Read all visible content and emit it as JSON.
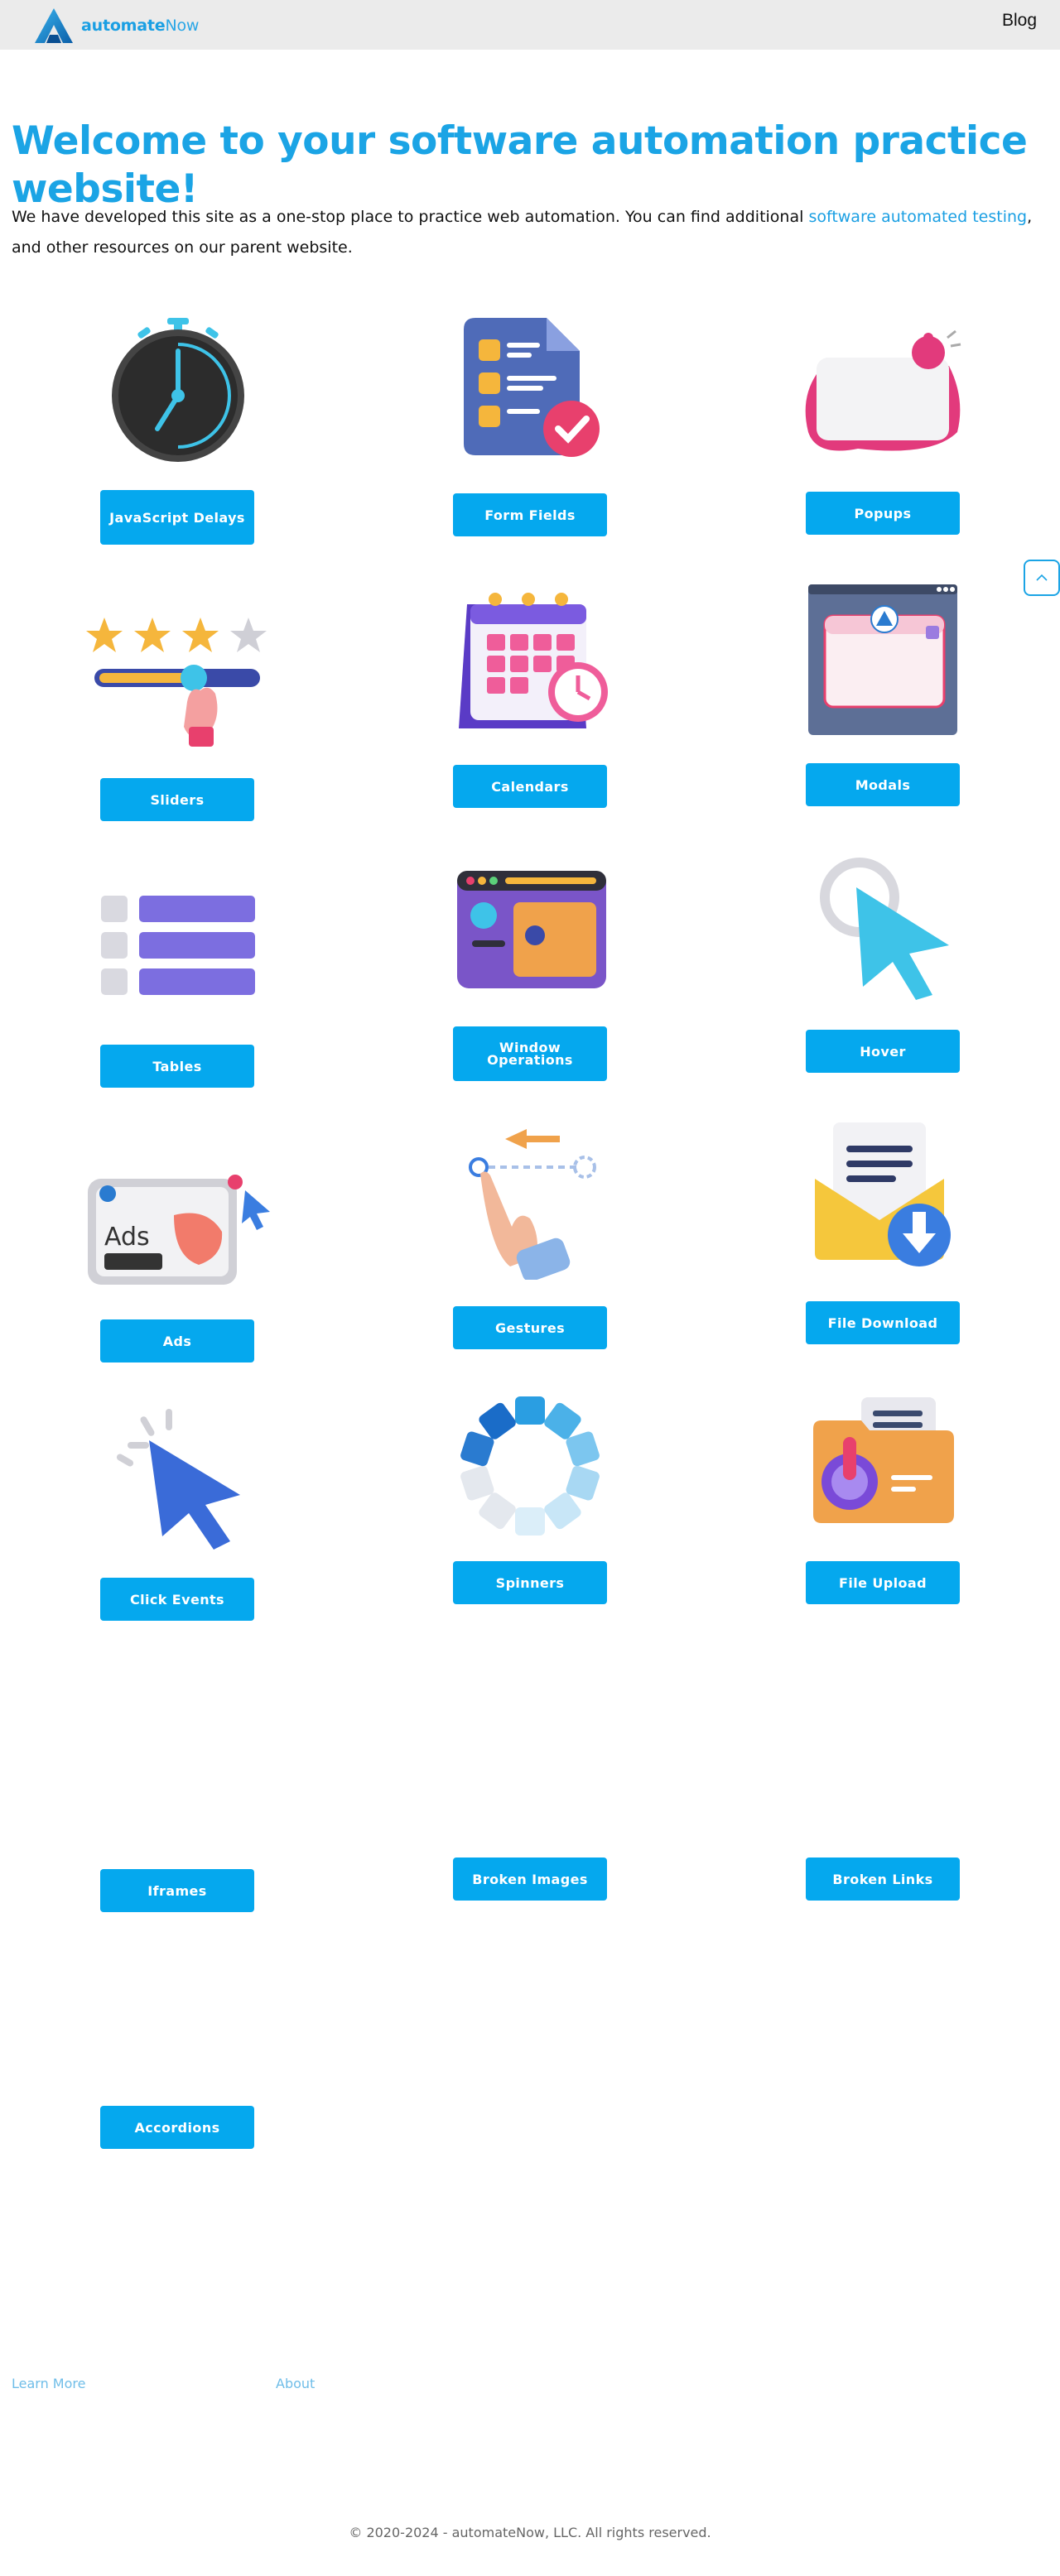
{
  "header": {
    "logo_text_bold": "automate",
    "logo_text_light": "Now",
    "nav_blog": "Blog"
  },
  "main": {
    "title": "Welcome to your software automation practice website!",
    "intro_before": "We have developed this site as a one-stop place to practice web automation. You can find additional ",
    "intro_link": "software automated testing",
    "intro_after": ", and other resources on our parent website."
  },
  "cards": [
    {
      "label": "JavaScript Delays",
      "icon": "stopwatch-icon"
    },
    {
      "label": "Form Fields",
      "icon": "form-document-icon"
    },
    {
      "label": "Popups",
      "icon": "popup-bell-icon"
    },
    {
      "label": "Sliders",
      "icon": "stars-slider-icon"
    },
    {
      "label": "Calendars",
      "icon": "calendar-clock-icon"
    },
    {
      "label": "Modals",
      "icon": "modal-window-icon"
    },
    {
      "label": "Tables",
      "icon": "table-rows-icon"
    },
    {
      "label": "Window Operations",
      "icon": "browser-window-icon"
    },
    {
      "label": "Hover",
      "icon": "hover-cursor-icon"
    },
    {
      "label": "Ads",
      "icon": "ad-banner-icon"
    },
    {
      "label": "Gestures",
      "icon": "swipe-hand-icon"
    },
    {
      "label": "File Download",
      "icon": "envelope-download-icon"
    },
    {
      "label": "Click Events",
      "icon": "click-cursor-icon"
    },
    {
      "label": "Spinners",
      "icon": "loading-spinner-icon"
    },
    {
      "label": "File Upload",
      "icon": "folder-upload-icon"
    },
    {
      "label": "Iframes",
      "icon": ""
    },
    {
      "label": "Broken Images",
      "icon": ""
    },
    {
      "label": "Broken Links",
      "icon": ""
    },
    {
      "label": "Accordions",
      "icon": ""
    }
  ],
  "scroll_top": {
    "icon": "chevron-up-icon"
  },
  "footer": {
    "learn_more": "Learn More",
    "about": "About",
    "copyright": "© 2020-2024 - automateNow, LLC. All rights reserved."
  },
  "colors": {
    "accent": "#1ba4e5",
    "button": "#05a8ee",
    "topbar": "#ebebeb"
  }
}
